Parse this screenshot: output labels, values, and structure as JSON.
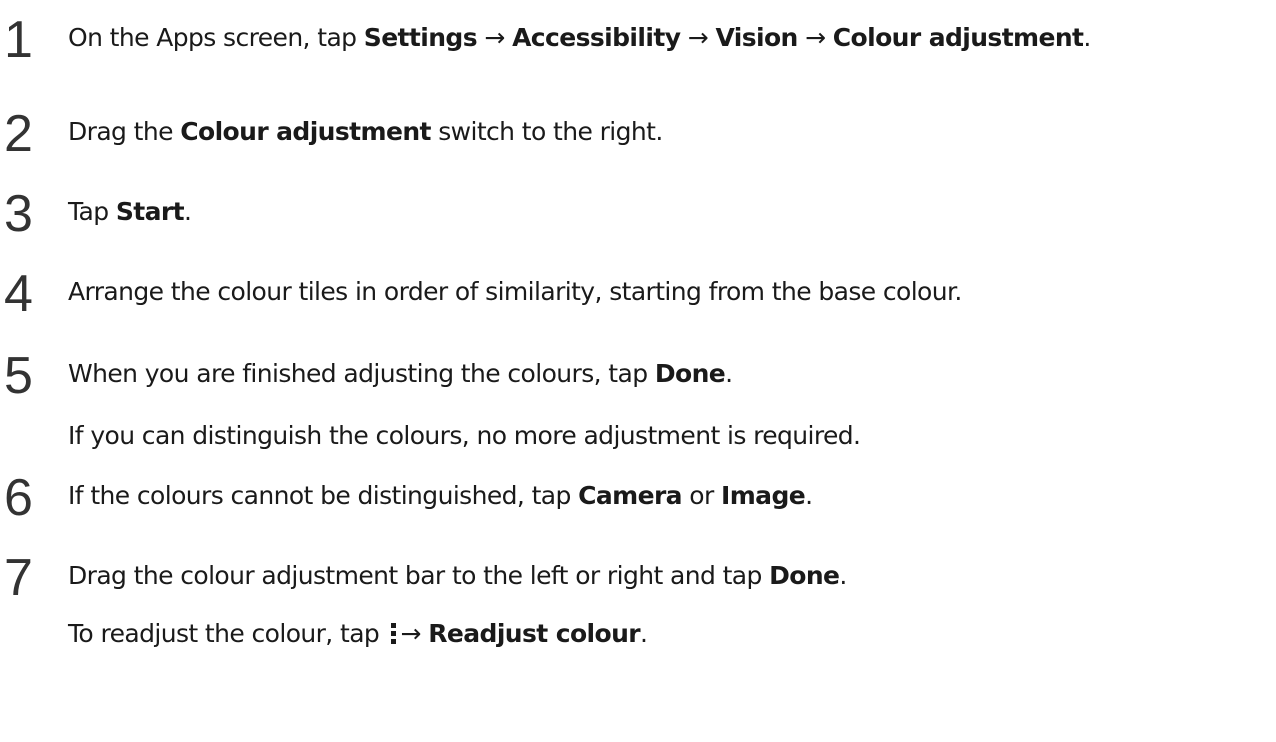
{
  "steps": [
    {
      "number": "1",
      "lines": [
        {
          "segments": [
            {
              "text": "On the Apps screen, tap ",
              "bold": false
            },
            {
              "text": "Settings",
              "bold": true
            },
            {
              "text": " → ",
              "bold": false
            },
            {
              "text": "Accessibility",
              "bold": true
            },
            {
              "text": " → ",
              "bold": false
            },
            {
              "text": "Vision",
              "bold": true
            },
            {
              "text": " → ",
              "bold": false
            },
            {
              "text": "Colour adjustment",
              "bold": true
            },
            {
              "text": ".",
              "bold": false
            }
          ]
        }
      ]
    },
    {
      "number": "2",
      "lines": [
        {
          "segments": [
            {
              "text": "Drag the ",
              "bold": false
            },
            {
              "text": "Colour adjustment",
              "bold": true
            },
            {
              "text": " switch to the right.",
              "bold": false
            }
          ]
        }
      ]
    },
    {
      "number": "3",
      "lines": [
        {
          "segments": [
            {
              "text": "Tap ",
              "bold": false
            },
            {
              "text": "Start",
              "bold": true
            },
            {
              "text": ".",
              "bold": false
            }
          ]
        }
      ]
    },
    {
      "number": "4",
      "lines": [
        {
          "segments": [
            {
              "text": "Arrange the colour tiles in order of similarity, starting from the base colour.",
              "bold": false
            }
          ]
        }
      ]
    },
    {
      "number": "5",
      "lines": [
        {
          "segments": [
            {
              "text": "When you are finished adjusting the colours, tap ",
              "bold": false
            },
            {
              "text": "Done",
              "bold": true
            },
            {
              "text": ".",
              "bold": false
            }
          ]
        },
        {
          "segments": [
            {
              "text": "If you can distinguish the colours, no more adjustment is required.",
              "bold": false
            }
          ]
        }
      ]
    },
    {
      "number": "6",
      "lines": [
        {
          "segments": [
            {
              "text": "If the colours cannot be distinguished, tap ",
              "bold": false
            },
            {
              "text": "Camera",
              "bold": true
            },
            {
              "text": " or ",
              "bold": false
            },
            {
              "text": "Image",
              "bold": true
            },
            {
              "text": ".",
              "bold": false
            }
          ]
        }
      ]
    },
    {
      "number": "7",
      "lines": [
        {
          "segments": [
            {
              "text": "Drag the colour adjustment bar to the left or right and tap ",
              "bold": false
            },
            {
              "text": "Done",
              "bold": true
            },
            {
              "text": ".",
              "bold": false
            }
          ]
        },
        {
          "segments": [
            {
              "text": "To readjust the colour, tap ",
              "bold": false
            },
            {
              "icon": "more-options-icon"
            },
            {
              "text": "→ ",
              "bold": false
            },
            {
              "text": "Readjust colour",
              "bold": true
            },
            {
              "text": ".",
              "bold": false
            }
          ]
        }
      ]
    }
  ]
}
